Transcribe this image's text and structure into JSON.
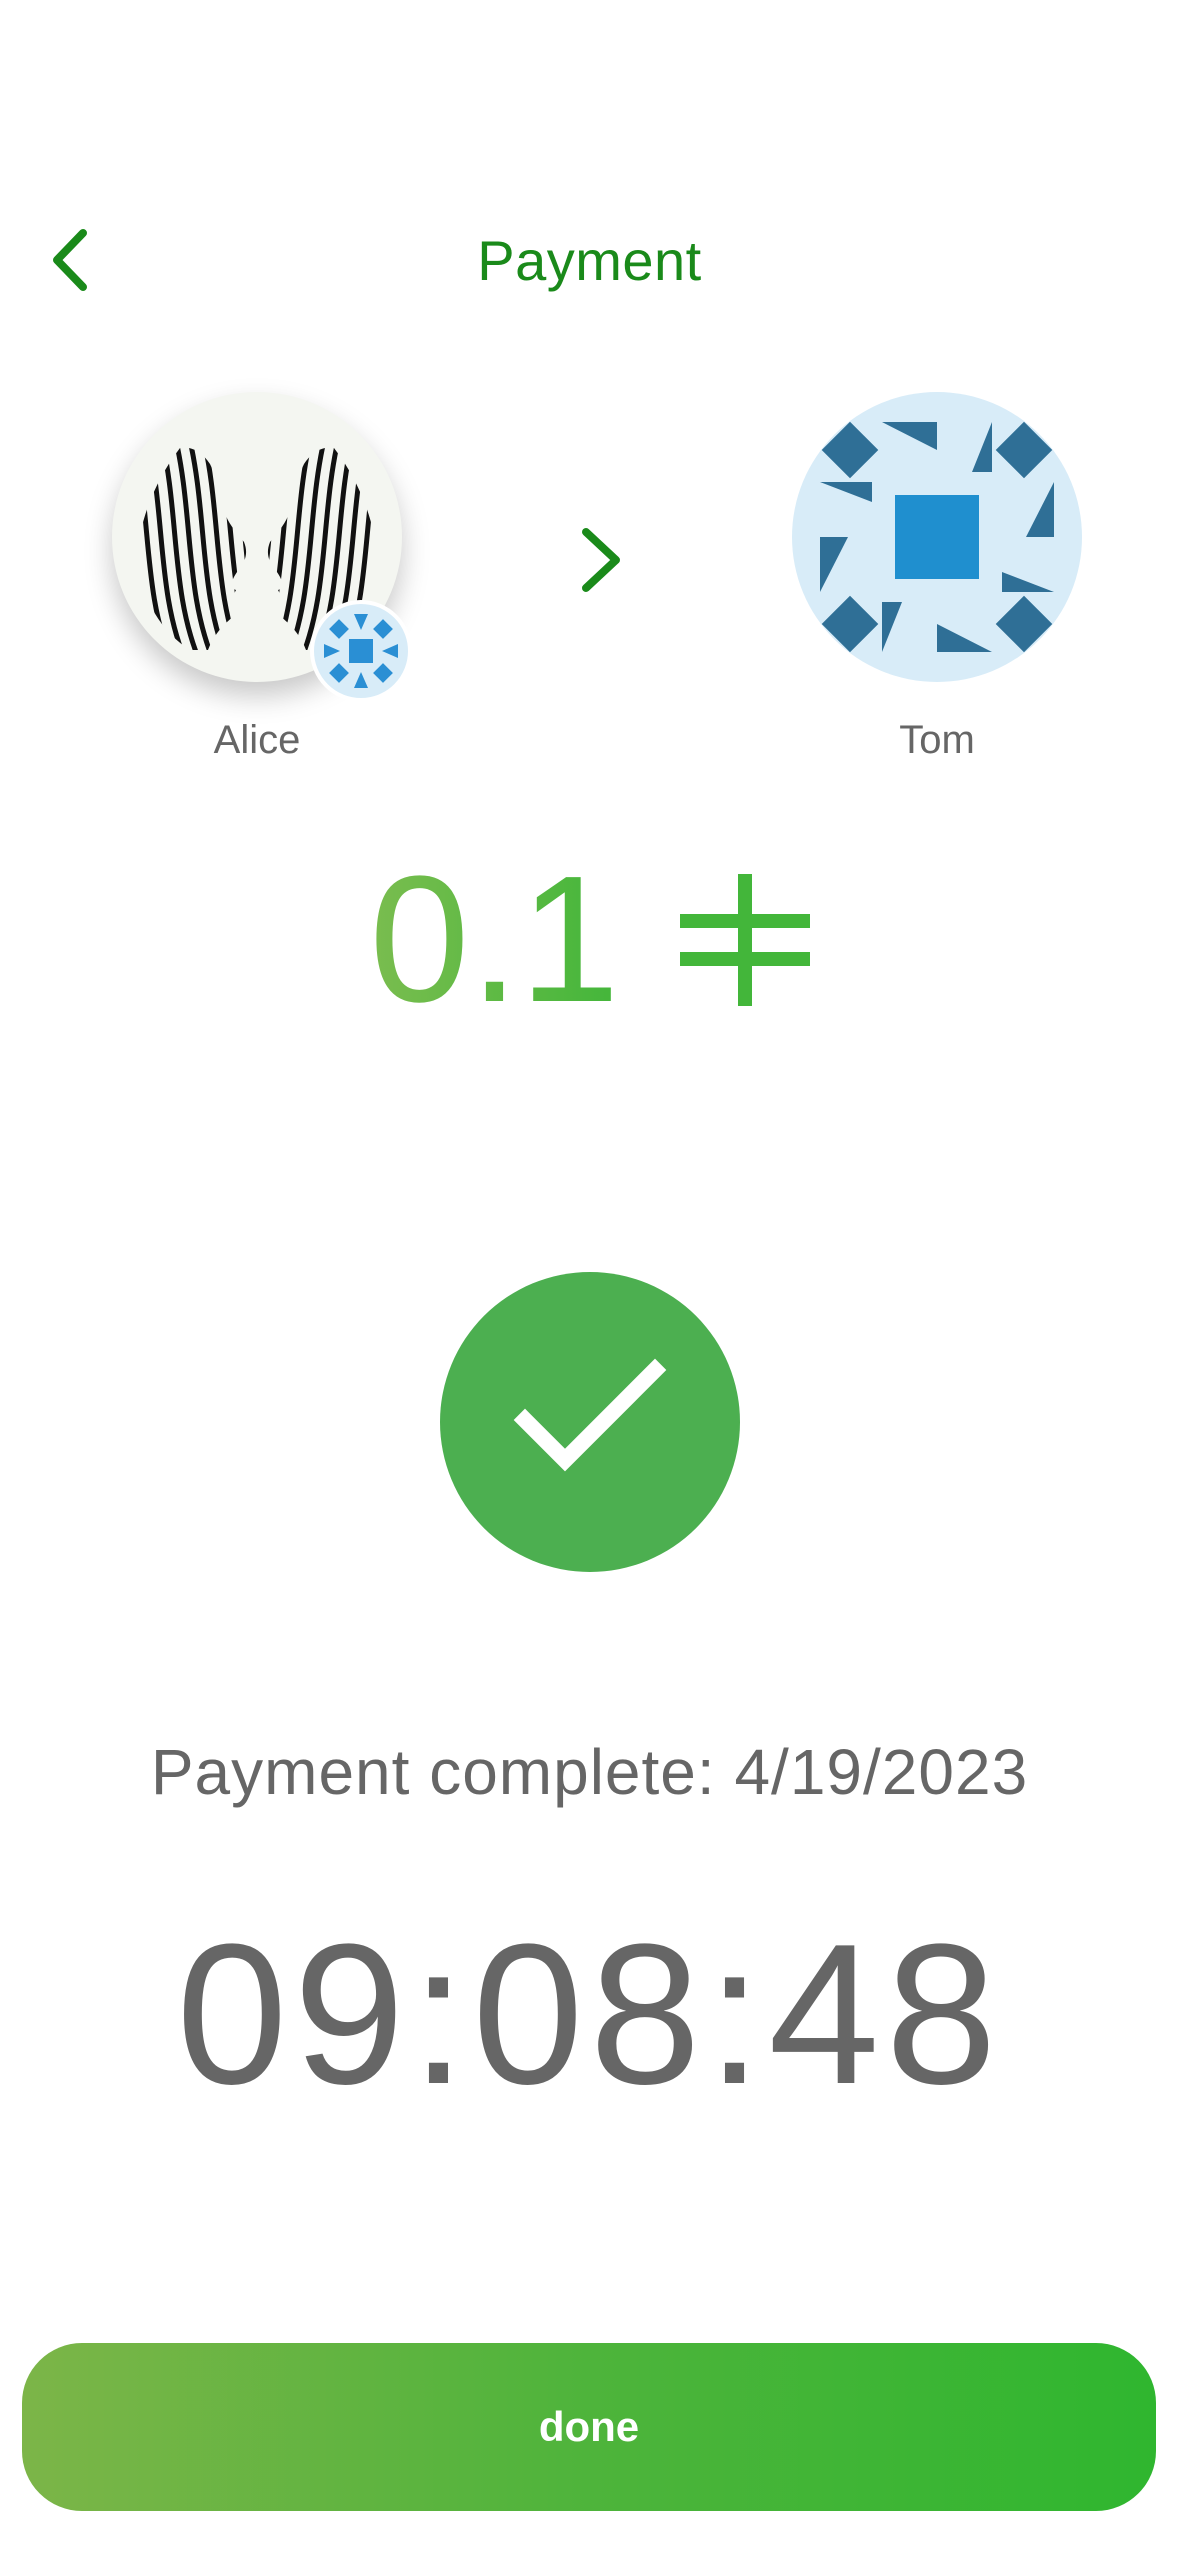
{
  "header": {
    "title": "Payment",
    "back_icon": "chevron-left-icon"
  },
  "sender": {
    "name": "Alice",
    "avatar": "two-faces-line-art-avatar",
    "badge": "blue-geometric-badge"
  },
  "transfer_icon": "chevron-right-icon",
  "recipient": {
    "name": "Tom",
    "avatar": "blue-geometric-pattern-avatar"
  },
  "amount": {
    "value": "0.1",
    "currency_icon": "currency-symbol-icon"
  },
  "status_icon": "checkmark-circle-icon",
  "status_text": "Payment complete: 4/19/2023",
  "time": "09:08:48",
  "done_button": "done",
  "colors": {
    "accent": "#1a8a1a",
    "success": "#4caf50",
    "text_muted": "#666666",
    "amount_gradient_start": "#7abd4f",
    "amount_gradient_end": "#43b63a",
    "button_gradient_start": "#7cb548",
    "button_gradient_end": "#2fb62f"
  }
}
